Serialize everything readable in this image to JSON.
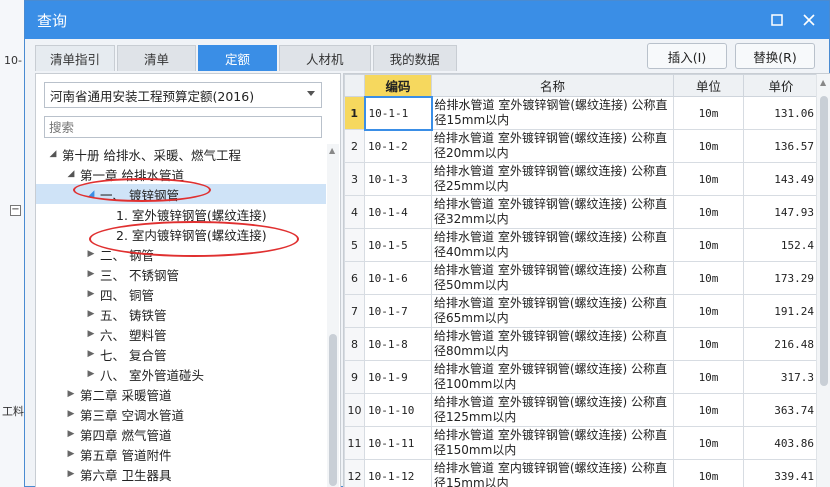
{
  "background": {
    "left_labels": [
      "10-",
      "工料"
    ],
    "right_label": "",
    "minus_icon": "minus-box-icon"
  },
  "dialog": {
    "title": "查询",
    "maximize_icon": "maximize-icon",
    "close_icon": "close-icon"
  },
  "tabs": [
    {
      "label": "清单指引"
    },
    {
      "label": "清单"
    },
    {
      "label": "定额",
      "active": true
    },
    {
      "label": "人材机"
    },
    {
      "label": "我的数据"
    }
  ],
  "actions": {
    "insert_label": "插入(I)",
    "replace_label": "替换(R)"
  },
  "left": {
    "quota_select": "河南省通用安装工程预算定额(2016)",
    "search_placeholder": "搜索",
    "tree": [
      {
        "label": "第十册 给排水、采暖、燃气工程",
        "level": 0,
        "arrow": "open"
      },
      {
        "label": "第一章 给排水管道",
        "level": 1,
        "arrow": "open"
      },
      {
        "label": "一、 镀锌钢管",
        "level": 2,
        "arrow": "open-sel",
        "selected": true
      },
      {
        "label": "1. 室外镀锌钢管(螺纹连接)",
        "level": 3,
        "arrow": "none"
      },
      {
        "label": "2. 室内镀锌钢管(螺纹连接)",
        "level": 3,
        "arrow": "none"
      },
      {
        "label": "二、 钢管",
        "level": 2,
        "arrow": "closed"
      },
      {
        "label": "三、 不锈钢管",
        "level": 2,
        "arrow": "closed"
      },
      {
        "label": "四、 铜管",
        "level": 2,
        "arrow": "closed"
      },
      {
        "label": "五、 铸铁管",
        "level": 2,
        "arrow": "closed"
      },
      {
        "label": "六、 塑料管",
        "level": 2,
        "arrow": "closed"
      },
      {
        "label": "七、 复合管",
        "level": 2,
        "arrow": "closed"
      },
      {
        "label": "八、 室外管道碰头",
        "level": 2,
        "arrow": "closed"
      },
      {
        "label": "第二章 采暖管道",
        "level": 1,
        "arrow": "closed"
      },
      {
        "label": "第三章 空调水管道",
        "level": 1,
        "arrow": "closed"
      },
      {
        "label": "第四章 燃气管道",
        "level": 1,
        "arrow": "closed"
      },
      {
        "label": "第五章 管道附件",
        "level": 1,
        "arrow": "closed"
      },
      {
        "label": "第六章 卫生器具",
        "level": 1,
        "arrow": "closed"
      }
    ]
  },
  "grid": {
    "columns": [
      "",
      "编码",
      "名称",
      "单位",
      "单价"
    ],
    "rows": [
      {
        "idx": "1",
        "code": "10-1-1",
        "name": "给排水管道 室外镀锌钢管(螺纹连接) 公称直径15mm以内",
        "unit": "10m",
        "price": "131.06"
      },
      {
        "idx": "2",
        "code": "10-1-2",
        "name": "给排水管道 室外镀锌钢管(螺纹连接) 公称直径20mm以内",
        "unit": "10m",
        "price": "136.57"
      },
      {
        "idx": "3",
        "code": "10-1-3",
        "name": "给排水管道 室外镀锌钢管(螺纹连接) 公称直径25mm以内",
        "unit": "10m",
        "price": "143.49"
      },
      {
        "idx": "4",
        "code": "10-1-4",
        "name": "给排水管道 室外镀锌钢管(螺纹连接) 公称直径32mm以内",
        "unit": "10m",
        "price": "147.93"
      },
      {
        "idx": "5",
        "code": "10-1-5",
        "name": "给排水管道 室外镀锌钢管(螺纹连接) 公称直径40mm以内",
        "unit": "10m",
        "price": "152.4"
      },
      {
        "idx": "6",
        "code": "10-1-6",
        "name": "给排水管道 室外镀锌钢管(螺纹连接) 公称直径50mm以内",
        "unit": "10m",
        "price": "173.29"
      },
      {
        "idx": "7",
        "code": "10-1-7",
        "name": "给排水管道 室外镀锌钢管(螺纹连接) 公称直径65mm以内",
        "unit": "10m",
        "price": "191.24"
      },
      {
        "idx": "8",
        "code": "10-1-8",
        "name": "给排水管道 室外镀锌钢管(螺纹连接) 公称直径80mm以内",
        "unit": "10m",
        "price": "216.48"
      },
      {
        "idx": "9",
        "code": "10-1-9",
        "name": "给排水管道 室外镀锌钢管(螺纹连接) 公称直径100mm以内",
        "unit": "10m",
        "price": "317.3"
      },
      {
        "idx": "10",
        "code": "10-1-10",
        "name": "给排水管道 室外镀锌钢管(螺纹连接) 公称直径125mm以内",
        "unit": "10m",
        "price": "363.74"
      },
      {
        "idx": "11",
        "code": "10-1-11",
        "name": "给排水管道 室外镀锌钢管(螺纹连接) 公称直径150mm以内",
        "unit": "10m",
        "price": "403.86"
      },
      {
        "idx": "12",
        "code": "10-1-12",
        "name": "给排水管道 室内镀锌钢管(螺纹连接) 公称直径15mm以内",
        "unit": "10m",
        "price": "339.41"
      }
    ]
  },
  "colors": {
    "accent": "#3a8ee6",
    "highlight": "#f6d85e",
    "annotation": "#e03030"
  }
}
